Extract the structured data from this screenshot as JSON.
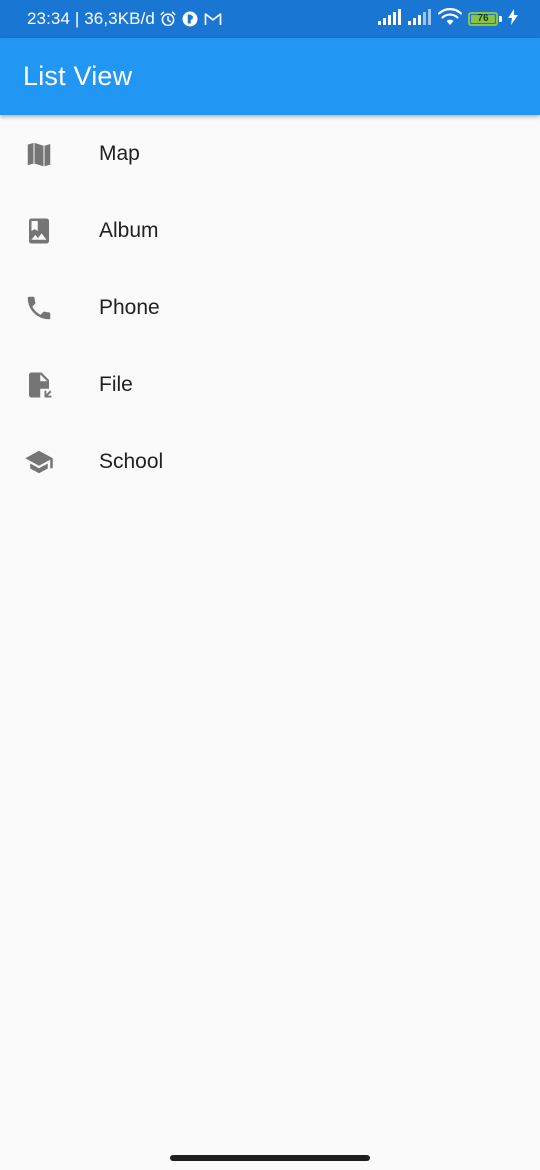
{
  "status_bar": {
    "time_speed": "23:34 | 36,3KB/d",
    "battery": "76",
    "icons": [
      "alarm-icon",
      "app-notification-icon",
      "gmail-icon",
      "signal-icon",
      "signal-icon",
      "wifi-icon",
      "battery-icon",
      "charging-icon"
    ]
  },
  "app_bar": {
    "title": "List View"
  },
  "list": {
    "items": [
      {
        "label": "Map",
        "icon": "map-icon"
      },
      {
        "label": "Album",
        "icon": "photo-album-icon"
      },
      {
        "label": "Phone",
        "icon": "phone-icon"
      },
      {
        "label": "File",
        "icon": "file-icon"
      },
      {
        "label": "School",
        "icon": "school-icon"
      }
    ]
  },
  "colors": {
    "status_bar": "#1976d2",
    "app_bar": "#2196f3",
    "background": "#fafafa",
    "icon": "#757575",
    "text": "#212121",
    "battery": "#8bc34a"
  }
}
